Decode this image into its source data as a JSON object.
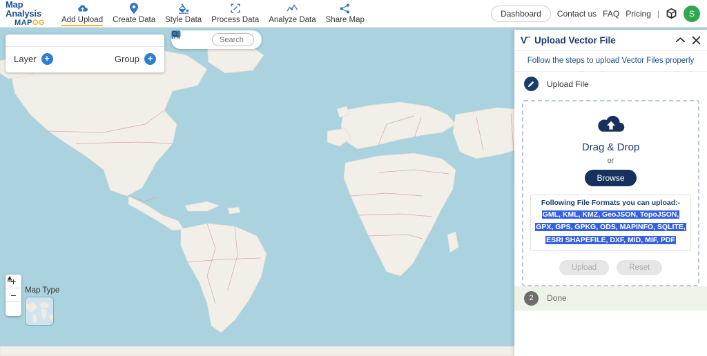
{
  "header": {
    "brand_title": "Map Analysis",
    "brand_sub_a": "MAP",
    "brand_sub_b": "OG",
    "nav": [
      {
        "label": "Add Upload",
        "icon": "cloud-upload-icon",
        "active": true
      },
      {
        "label": "Create Data",
        "icon": "map-pin-icon",
        "active": false
      },
      {
        "label": "Style Data",
        "icon": "paint-bucket-icon",
        "active": false
      },
      {
        "label": "Process Data",
        "icon": "transform-icon",
        "active": false
      },
      {
        "label": "Analyze Data",
        "icon": "analytics-icon",
        "active": false
      },
      {
        "label": "Share Map",
        "icon": "share-icon",
        "active": false
      }
    ],
    "dashboard_label": "Dashboard",
    "contact_label": "Contact us",
    "faq_label": "FAQ",
    "pricing_label": "Pricing",
    "separator": "|",
    "cube_icon": "cube-icon",
    "avatar_initial": "S",
    "avatar_color": "#2ea84f"
  },
  "map": {
    "layer_panel": {
      "layer_label": "Layer",
      "layer_add_icon": "plus-icon",
      "group_label": "Group",
      "group_add_icon": "plus-icon"
    },
    "toolbar": {
      "icons": [
        "fullscreen-icon",
        "print-icon",
        "compare-icon",
        "comment-icon"
      ],
      "search_placeholder": "Search",
      "search_value": "",
      "search_icon": "search-icon"
    },
    "zoom_controls": {
      "zoom_in": "+",
      "zoom_out": "−",
      "compass_icon": "compass-north-icon"
    },
    "map_type_label": "Map Type",
    "chat_icon": "chat-bubble-icon",
    "info_icon": "info-icon",
    "ocean_color": "#aad3df",
    "land_color": "#f2efe8",
    "border_color": "#d9a3a8"
  },
  "panel": {
    "v_icon": "V˝",
    "title": "Upload Vector File",
    "collapse_icon": "chevron-up-icon",
    "close_icon": "close-icon",
    "subtitle": "Follow the steps to upload Vector Files properly",
    "step1": {
      "badge_icon": "pencil-icon",
      "label": "Upload File"
    },
    "step2": {
      "badge": "2",
      "label": "Done"
    },
    "dropzone": {
      "cloud_icon": "cloud-upload-icon",
      "title": "Drag & Drop",
      "or": "or",
      "browse_label": "Browse",
      "formats_title": "Following File Formats you can upload:-",
      "formats_list": "GML, KML, KMZ, GeoJSON, TopoJSON, GPX, GPS, GPKG, ODS, MAPINFO, SQLITE, ESRI SHAPEFILE, DXF, MID, MIF, PDF",
      "upload_label": "Upload",
      "reset_label": "Reset"
    }
  }
}
